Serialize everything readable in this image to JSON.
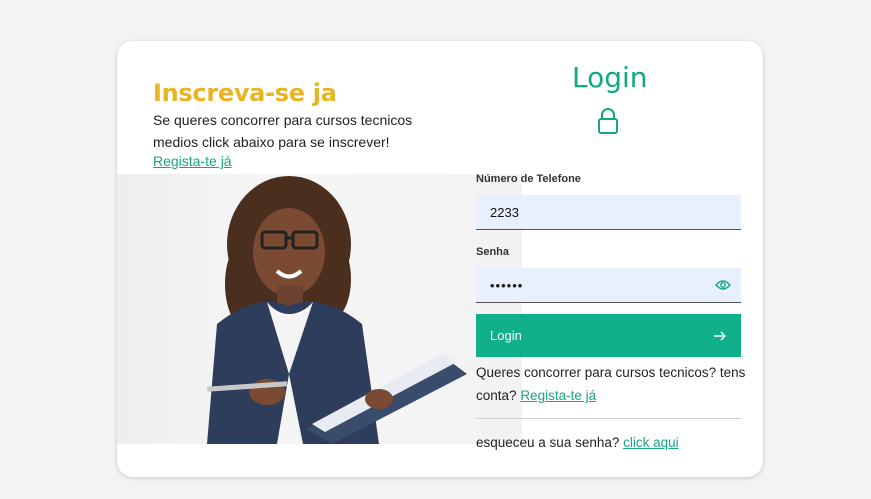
{
  "signup": {
    "title": "Inscreva-se ja",
    "description": "Se queres concorrer para cursos tecnicos medios click abaixo para se inscrever!",
    "link": "Regista-te já"
  },
  "login": {
    "title": "Login",
    "phone_label": "Número de Telefone",
    "phone_value": "2233",
    "password_label": "Senha",
    "password_value": "••••••",
    "button_label": "Login",
    "register_text": "Queres concorrer para cursos tecnicos? tens conta?",
    "register_link": "Regista-te já",
    "forgot_text": "esqueceu a sua senha?",
    "forgot_link": "click aqui"
  },
  "colors": {
    "accent": "#0fb08a",
    "heading_yellow": "#e8b422",
    "input_bg": "#e8f0fe"
  },
  "icons": [
    "lock-icon",
    "eye-icon",
    "arrow-right-icon"
  ]
}
